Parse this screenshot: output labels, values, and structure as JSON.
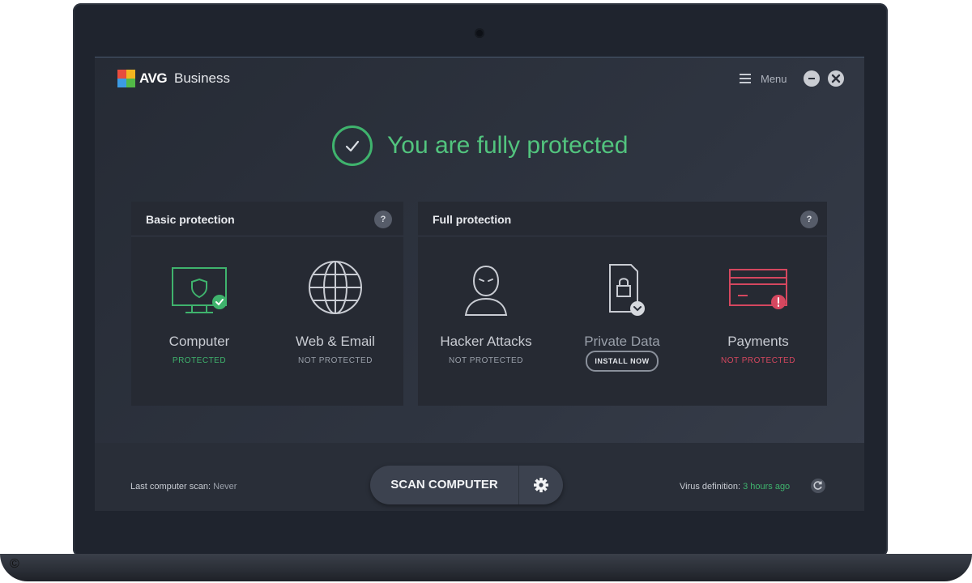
{
  "app": {
    "brand": "AVG",
    "product": "Business",
    "menu_label": "Menu"
  },
  "status": {
    "message": "You are fully protected"
  },
  "panels": {
    "basic": {
      "title": "Basic protection",
      "help": "?",
      "features": [
        {
          "label": "Computer",
          "status": "PROTECTED",
          "icon": "monitor-shield-icon"
        },
        {
          "label": "Web & Email",
          "status": "NOT PROTECTED",
          "icon": "globe-icon"
        }
      ]
    },
    "full": {
      "title": "Full protection",
      "help": "?",
      "features": [
        {
          "label": "Hacker Attacks",
          "status": "NOT PROTECTED",
          "icon": "hacker-icon"
        },
        {
          "label": "Private Data",
          "action": "INSTALL NOW",
          "icon": "lock-document-icon"
        },
        {
          "label": "Payments",
          "status": "NOT PROTECTED",
          "icon": "credit-card-icon"
        }
      ]
    }
  },
  "bottom": {
    "last_scan_label": "Last computer scan:",
    "last_scan_value": "Never",
    "scan_button": "SCAN COMPUTER",
    "virus_def_label": "Virus definition:",
    "virus_def_value": "3 hours ago"
  },
  "footer": {
    "copyright": "©"
  },
  "colors": {
    "accent_green": "#3fb36d",
    "alert_red": "#d5475f",
    "background": "#2f3541"
  }
}
